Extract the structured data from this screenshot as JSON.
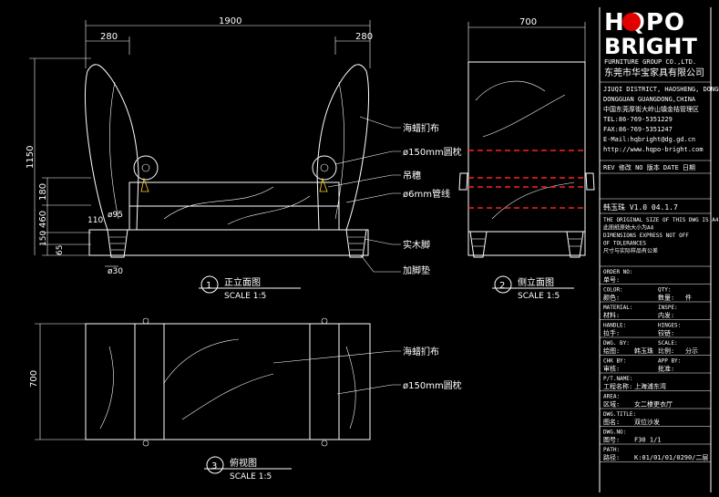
{
  "brand": {
    "logo_top": "HQPO",
    "logo_bottom": "BRIGHT",
    "subtitle": "FURNITURE GROUP CO.,LTD.",
    "company_cn": "东莞市华宝家具有限公司"
  },
  "company_info": [
    "JIUQI DISTRICT, HAOSHENG, DONGHUA",
    "DONGGUAN GUANGDONG,CHINA",
    "中国东莞厚街大岭山镇金桔管理区",
    "TEL:86-769-5351229",
    "FAX:86-769-5351247",
    "E-Mail:hqbright@dg.gd.cn",
    "http://www.hqpo-bright.com"
  ],
  "rev_row": "REV 修改  NO 版本  DATE 日期",
  "rev_value": "韩玉珠   V1.0   04.1.7",
  "notes": [
    "THE ORIGINAL SIZE OF THIS DWG IS A4",
    "此图纸原始大小为A4",
    "DIMENSIONS EXPRESS NOT OFF",
    "OF TOLERANCES",
    "尺寸与实际样品有公差"
  ],
  "title_block": [
    {
      "en": "ORDER NO:",
      "cn": "单号:",
      "value": ""
    },
    {
      "en": "COLOR:",
      "cn": "颜色:",
      "en2": "QTY:",
      "cn2": "数量:",
      "value2": "件"
    },
    {
      "en": "MATERIAL:",
      "cn": "材料:",
      "en2": "INSPE:",
      "cn2": "内发:",
      "value2": ""
    },
    {
      "en": "HANDLE:",
      "cn": "拉手:",
      "en2": "HINGES:",
      "cn2": "铰链:",
      "value2": ""
    },
    {
      "en": "DWG. BY:",
      "cn": "绘图:",
      "value": "韩玉珠",
      "en2": "SCALE:",
      "cn2": "比例:",
      "value2": "分示"
    },
    {
      "en": "CHK BY:",
      "cn": "审核:",
      "en2": "APP BY:",
      "cn2": "批准:",
      "value2": ""
    },
    {
      "en": "P/T.NAME:",
      "cn": "工程名称:",
      "value": "上海浦东湾"
    },
    {
      "en": "AREA:",
      "cn": "区域:",
      "value": "女二楼更衣厅"
    },
    {
      "en": "DWG.TITLE:",
      "cn": "图名:",
      "value": "双位沙发"
    },
    {
      "en": "DWG.NO:",
      "cn": "图号:",
      "value": "F30     1/1"
    },
    {
      "en": "PATH:",
      "cn": "路径:",
      "value": "K:01/01/01/0290/二层"
    }
  ],
  "front_view": {
    "dims": {
      "total_width": "1900",
      "left_arm": "280",
      "right_arm": "280",
      "height_total": "1150",
      "h_180": "180",
      "h_460": "460",
      "h_150": "150",
      "h_65": "65",
      "w_110": "110",
      "dia_95": "ø95",
      "dia_30": "ø30"
    },
    "callouts": [
      "海蜡扪布",
      "ø150mm圆枕",
      "吊穗",
      "ø6mm管线",
      "实木脚",
      "加脚垫"
    ],
    "label_num": "1",
    "label_cn": "正立面图",
    "scale": "SCALE 1:5"
  },
  "side_view": {
    "dims": {
      "width": "700"
    },
    "label_num": "2",
    "label_cn": "侧立面图",
    "scale": "SCALE 1:5"
  },
  "plan_view": {
    "dims": {
      "depth": "700"
    },
    "callouts": [
      "海蜡扪布",
      "ø150mm圆枕"
    ],
    "label_num": "3",
    "label_cn": "俯视图",
    "scale": "SCALE 1:5"
  },
  "colors": {
    "background": "#000000",
    "lines": "#ffffff",
    "accent": "#ff2020",
    "logo_o": "#e00000",
    "tassel": "#ffd21e"
  }
}
